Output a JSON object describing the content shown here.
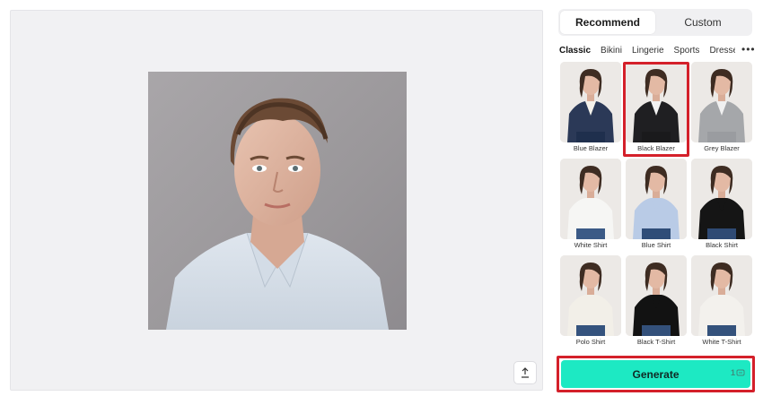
{
  "upload_icon": "upload-arrow-icon",
  "tabs": [
    {
      "label": "Recommend",
      "active": true
    },
    {
      "label": "Custom",
      "active": false
    }
  ],
  "categories": [
    {
      "label": "Classic",
      "active": true
    },
    {
      "label": "Bikini",
      "active": false
    },
    {
      "label": "Lingerie",
      "active": false
    },
    {
      "label": "Sports",
      "active": false
    },
    {
      "label": "Dresses",
      "active": false
    }
  ],
  "more_icon": "more-horizontal-icon",
  "outfits": [
    {
      "label": "Blue Blazer",
      "top": "#2b3957",
      "inner": "#f4f1ea",
      "bottom": "#1f2f4d",
      "selected": false
    },
    {
      "label": "Black Blazer",
      "top": "#1f1f22",
      "inner": "#f2f2f2",
      "bottom": "#1a1a1c",
      "selected": true
    },
    {
      "label": "Grey Blazer",
      "top": "#a5a7aa",
      "inner": "#f0f0f0",
      "bottom": "#9a9ca0",
      "selected": false
    },
    {
      "label": "White Shirt",
      "top": "#f6f6f4",
      "inner": "#f6f6f4",
      "bottom": "#3b5a86",
      "selected": false
    },
    {
      "label": "Blue Shirt",
      "top": "#b9cbe6",
      "inner": "#b9cbe6",
      "bottom": "#2f4d78",
      "selected": false
    },
    {
      "label": "Black Shirt",
      "top": "#151515",
      "inner": "#151515",
      "bottom": "#2f4a74",
      "selected": false
    },
    {
      "label": "Polo Shirt",
      "top": "#f2efe8",
      "inner": "#f2efe8",
      "bottom": "#35537e",
      "selected": false
    },
    {
      "label": "Black T-Shirt",
      "top": "#121212",
      "inner": "#121212",
      "bottom": "#33507a",
      "selected": false
    },
    {
      "label": "White T-Shirt",
      "top": "#f3f1ed",
      "inner": "#f3f1ed",
      "bottom": "#34527c",
      "selected": false
    }
  ],
  "generate": {
    "label": "Generate",
    "credits": "1",
    "credit_icon": "credit-coin-icon"
  },
  "colors": {
    "accent": "#1de9c3",
    "highlight": "#d4202a"
  }
}
